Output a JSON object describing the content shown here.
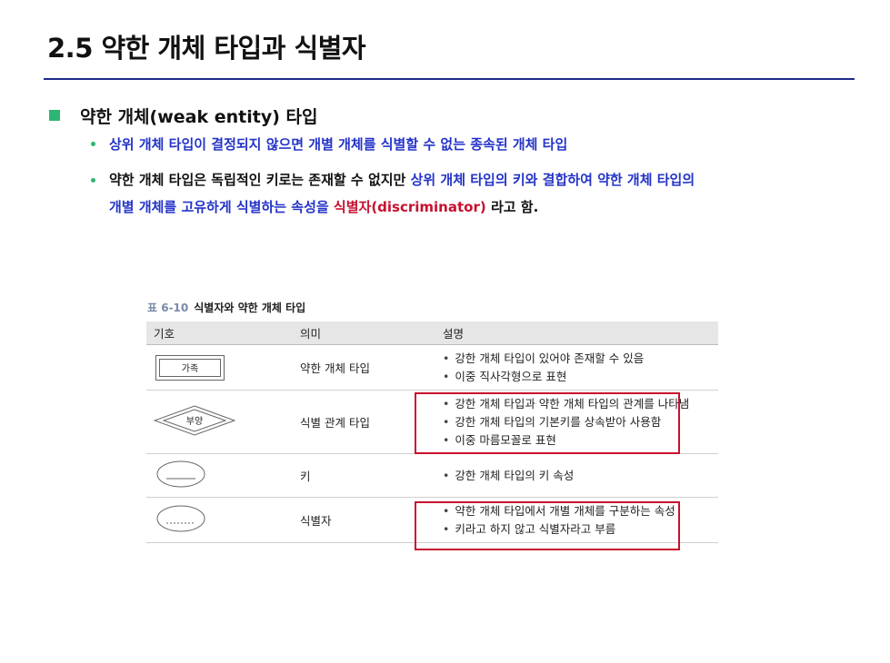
{
  "title": "2.5 약한 개체 타입과 식별자",
  "section": {
    "heading": "약한 개체(weak entity) 타입",
    "bullet1": "상위 개체 타입이 결정되지 않으면 개별 개체를 식별할 수 없는 종속된 개체 타입",
    "bullet2": {
      "part1": "약한 개체 타입은 독립적인 키로는 존재할 수 없지만 ",
      "part2": "상위 개체 타입의 키와 결합하여 약한 개체 타입의",
      "part3": "개별 개체를 고유하게 식별하는 속성을 ",
      "part4": "식별자(discriminator)",
      "part5": " 라고 함."
    }
  },
  "table": {
    "caption_num": "표 6-10",
    "caption_text": "식별자와 약한 개체 타입",
    "headers": [
      "기호",
      "의미",
      "설명"
    ],
    "rows": [
      {
        "symbol_label": "가족",
        "meaning": "약한 개체 타입",
        "desc": [
          "강한 개체 타입이 있어야 존재할 수 있음",
          "이중 직사각형으로 표현"
        ]
      },
      {
        "symbol_label": "부양",
        "meaning": "식별 관계 타입",
        "desc": [
          "강한 개체 타입과 약한 개체 타입의 관계를 나타냄",
          "강한 개체 타입의 기본키를 상속받아 사용함",
          "이중 마름모꼴로 표현"
        ]
      },
      {
        "symbol_label": "",
        "meaning": "키",
        "desc": [
          "강한 개체 타입의 키 속성"
        ]
      },
      {
        "symbol_label": "",
        "meaning": "식별자",
        "desc": [
          "약한 개체 타입에서 개별 개체를 구분하는 속성",
          "키라고 하지 않고 식별자라고 부름"
        ]
      }
    ]
  },
  "colors": {
    "accent_rule": "#1f2a8a",
    "bullet": "#2bb673",
    "emphasis_blue": "#2434c8",
    "emphasis_red": "#c8102e"
  }
}
